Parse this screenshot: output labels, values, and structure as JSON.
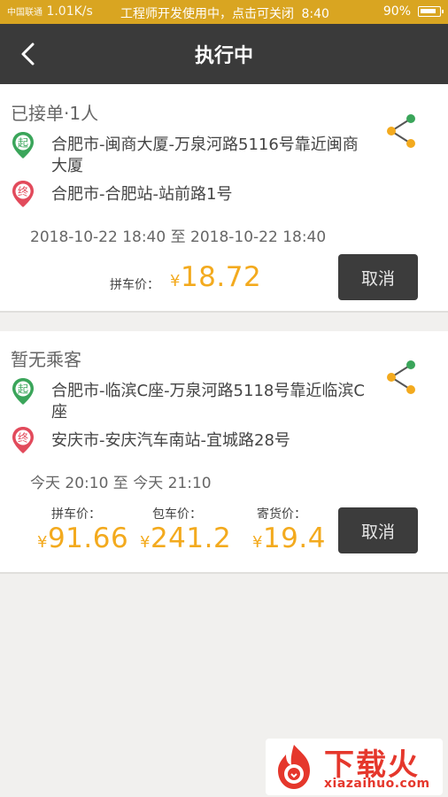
{
  "status_bar": {
    "network": "中国联通",
    "speed": "1.01K/s",
    "notification": "工程师开发使用中，点击可关闭",
    "time": "8:40",
    "battery": "90%"
  },
  "nav": {
    "title": "执行中"
  },
  "orders": [
    {
      "status": "已接单·1人",
      "start_badge": "起",
      "start_addr": "合肥市-闽商大厦-万泉河路5116号靠近闽商大厦",
      "end_badge": "终",
      "end_addr": "合肥市-合肥站-站前路1号",
      "time": "2018-10-22 18:40 至 2018-10-22 18:40",
      "prices": [
        {
          "label": "拼车价：",
          "currency": "¥",
          "value": "18.72"
        }
      ],
      "cancel_label": "取消"
    },
    {
      "status": "暂无乘客",
      "start_badge": "起",
      "start_addr": "合肥市-临滨C座-万泉河路5118号靠近临滨C座",
      "end_badge": "终",
      "end_addr": "安庆市-安庆汽车南站-宜城路28号",
      "time": "今天 20:10 至 今天 21:10",
      "prices": [
        {
          "label": "拼车价：",
          "currency": "¥",
          "value": "91.66"
        },
        {
          "label": "包车价：",
          "currency": "¥",
          "value": "241.2"
        },
        {
          "label": "寄货价：",
          "currency": "¥",
          "value": "19.4"
        }
      ],
      "cancel_label": "取消"
    }
  ],
  "watermark": {
    "title": "下载火",
    "url": "xiazaihuo.com"
  },
  "colors": {
    "status_bar": "#d9a521",
    "nav_bar": "#3a3a3a",
    "price": "#f3aa1e",
    "start_pin": "#3aa55a",
    "end_pin": "#e24a5b",
    "button": "#3c3c3c"
  }
}
